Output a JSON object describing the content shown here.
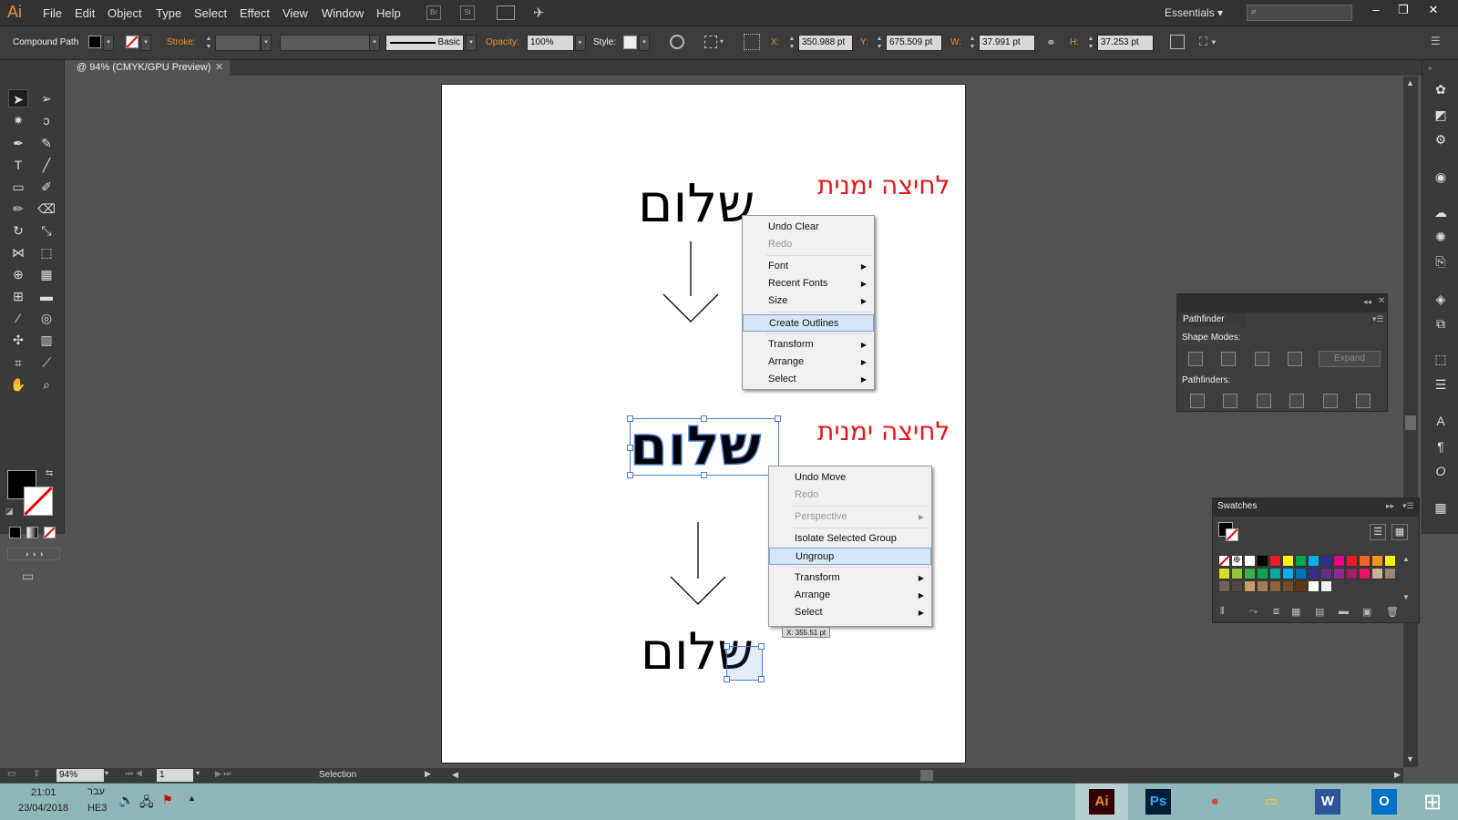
{
  "app": {
    "logo": "Ai"
  },
  "menu": [
    "File",
    "Edit",
    "Object",
    "Type",
    "Select",
    "Effect",
    "View",
    "Window",
    "Help"
  ],
  "menubar_icons": {
    "br": "Br",
    "st": "St"
  },
  "workspace": "Essentials",
  "control_bar": {
    "object_type": "Compound Path",
    "stroke_label": "Stroke:",
    "brush_label": "Basic",
    "opacity_label": "Opacity:",
    "opacity_value": "100%",
    "style_label": "Style:",
    "x_label": "X:",
    "x_value": "350.988 pt",
    "y_label": "Y:",
    "y_value": "675.509 pt",
    "w_label": "W:",
    "w_value": "37.991 pt",
    "h_label": "H:",
    "h_value": "37.253 pt"
  },
  "document_tab": "@ 94% (CMYK/GPU Preview)",
  "artboard": {
    "word": "שלום",
    "right_click_label": "לחיצה ימנית"
  },
  "context_menu_1": {
    "items": [
      {
        "label": "Undo Clear",
        "enabled": true,
        "submenu": false
      },
      {
        "label": "Redo",
        "enabled": false,
        "submenu": false
      },
      {
        "label": "Font",
        "enabled": true,
        "submenu": true
      },
      {
        "label": "Recent Fonts",
        "enabled": true,
        "submenu": true
      },
      {
        "label": "Size",
        "enabled": true,
        "submenu": true
      },
      {
        "label": "Create Outlines",
        "enabled": true,
        "submenu": false,
        "highlighted": true
      },
      {
        "label": "Transform",
        "enabled": true,
        "submenu": true
      },
      {
        "label": "Arrange",
        "enabled": true,
        "submenu": true
      },
      {
        "label": "Select",
        "enabled": true,
        "submenu": true
      }
    ]
  },
  "context_menu_2": {
    "items": [
      {
        "label": "Undo Move",
        "enabled": true,
        "submenu": false
      },
      {
        "label": "Redo",
        "enabled": false,
        "submenu": false
      },
      {
        "label": "Perspective",
        "enabled": false,
        "submenu": true
      },
      {
        "label": "Isolate Selected Group",
        "enabled": true,
        "submenu": false
      },
      {
        "label": "Ungroup",
        "enabled": true,
        "submenu": false,
        "highlighted": true
      },
      {
        "label": "Transform",
        "enabled": true,
        "submenu": true
      },
      {
        "label": "Arrange",
        "enabled": true,
        "submenu": true
      },
      {
        "label": "Select",
        "enabled": true,
        "submenu": true
      }
    ]
  },
  "move_tooltip": "X: 355.51 pt",
  "pathfinder": {
    "title": "Pathfinder",
    "shape_modes_label": "Shape Modes:",
    "expand_label": "Expand",
    "pathfinders_label": "Pathfinders:"
  },
  "swatches": {
    "title": "Swatches",
    "colors": [
      "#ffffff",
      "#000000",
      "#ed1c24",
      "#fff200",
      "#00a651",
      "#00aeef",
      "#2e3192",
      "#ec008c",
      "#ed1c24",
      "#f26522",
      "#f7941d",
      "#fff200",
      "#d7df23",
      "#8dc63f",
      "#39b54a",
      "#00a651",
      "#00a99d",
      "#00aeef",
      "#0072bc",
      "#2e3192",
      "#662d91",
      "#92278f",
      "#9e1f63",
      "#ed145b",
      "#c7b299",
      "#998675",
      "#736357",
      "#534741",
      "#c69c6d",
      "#a67c52",
      "#8c6239",
      "#754c24",
      "#603913",
      "#ffffff",
      "#f2f2f2"
    ]
  },
  "status_bar": {
    "zoom": "94%",
    "page": "1",
    "tool": "Selection"
  },
  "taskbar": {
    "time": "21:01",
    "date": "23/04/2018",
    "lang_top": "עבר",
    "lang_bottom": "HE3",
    "apps": [
      {
        "name": "illustrator",
        "label": "Ai",
        "color": "#e8902e",
        "bg": "#330000"
      },
      {
        "name": "photoshop",
        "label": "Ps",
        "color": "#31a8ff",
        "bg": "#001e36"
      },
      {
        "name": "chrome",
        "label": "●",
        "color": "#db4437",
        "bg": "transparent"
      },
      {
        "name": "explorer",
        "label": "▭",
        "color": "#e8c04a",
        "bg": "transparent"
      },
      {
        "name": "word",
        "label": "W",
        "color": "#ffffff",
        "bg": "#2b579a"
      },
      {
        "name": "outlook",
        "label": "O",
        "color": "#ffffff",
        "bg": "#0072c6"
      }
    ]
  }
}
